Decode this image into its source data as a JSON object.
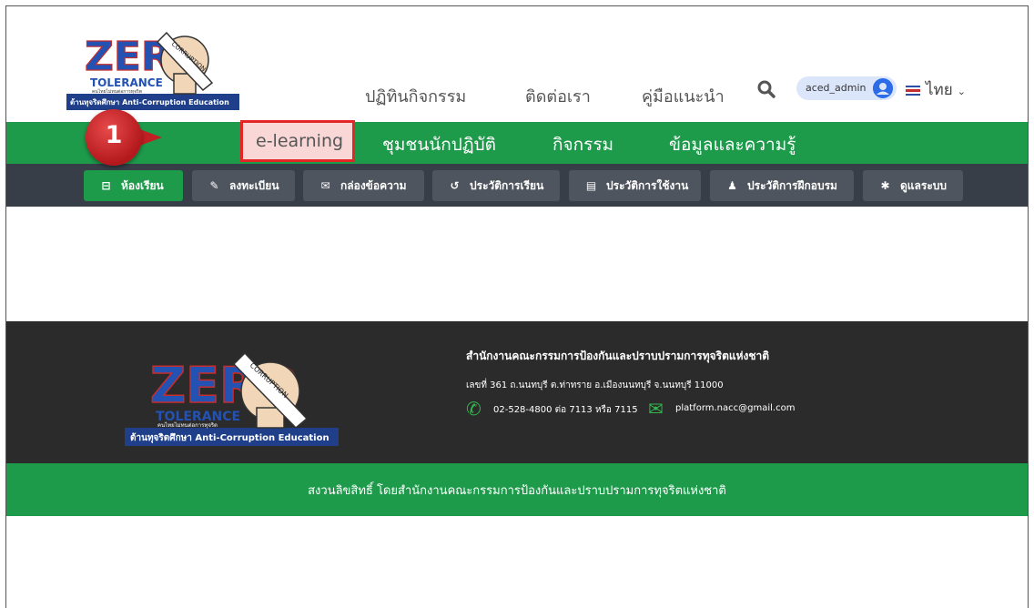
{
  "logo": {
    "word": "ZERO",
    "sub": "TOLERANCE",
    "tag": "คนไทยไม่ทนต่อการทุจริต",
    "band": "ต้านทุจริตศึกษา Anti-Corruption Education",
    "stamp": "CORRUPTION"
  },
  "topnav": {
    "items": [
      "ปฏิทินกิจกรรม",
      "ติดต่อเรา",
      "คู่มือแนะนำ"
    ],
    "username": "aced_admin",
    "language": "ไทย"
  },
  "greennav": {
    "items": [
      "e-learning",
      "ชุมชนนักปฏิบัติ",
      "กิจกรรม",
      "ข้อมูลและความรู้"
    ]
  },
  "step_badge": "1",
  "subnav": {
    "items": [
      {
        "label": "ห้องเรียน",
        "icon": "classroom-icon"
      },
      {
        "label": "ลงทะเบียน",
        "icon": "edit-icon"
      },
      {
        "label": "กล่องข้อความ",
        "icon": "envelope-icon"
      },
      {
        "label": "ประวัติการเรียน",
        "icon": "history-icon"
      },
      {
        "label": "ประวัติการใช้งาน",
        "icon": "list-icon"
      },
      {
        "label": "ประวัติการฝึกอบรม",
        "icon": "user-icon"
      },
      {
        "label": "ดูแลระบบ",
        "icon": "gear-icon"
      }
    ]
  },
  "footer": {
    "org": "สำนักงานคณะกรรมการป้องกันและปราบปรามการทุจริตแห่งชาติ",
    "address": "เลขที่ 361 ถ.นนทบุรี ต.ท่าทราย อ.เมืองนนทบุรี จ.นนทบุรี 11000",
    "phone": "02-528-4800 ต่อ 7113 หรือ 7115",
    "email": "platform.nacc@gmail.com",
    "copyright": "สงวนลิขสิทธิ์ โดยสำนักงานคณะกรรมการป้องกันและปราบปรามการทุจริตแห่งชาติ"
  }
}
